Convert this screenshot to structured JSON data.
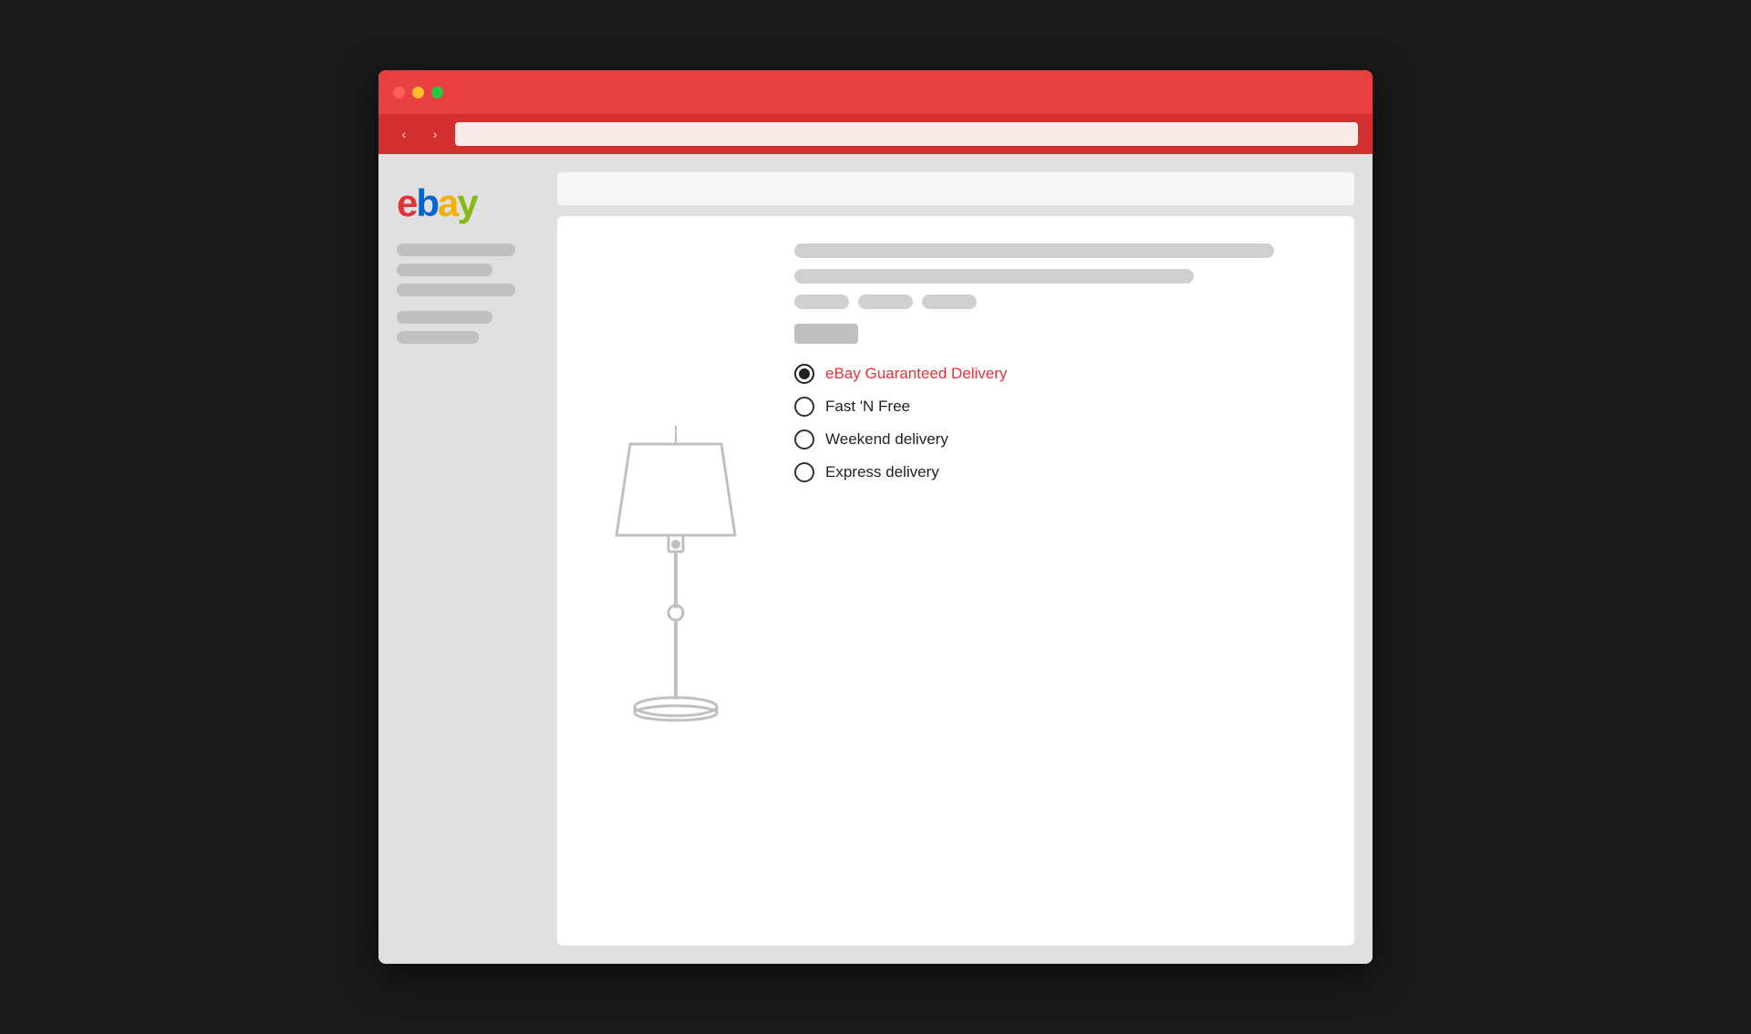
{
  "browser": {
    "title_bar": {
      "traffic_lights": [
        "red",
        "yellow",
        "green"
      ]
    },
    "nav": {
      "back_label": "‹",
      "forward_label": "›"
    }
  },
  "ebay": {
    "logo": {
      "e": "e",
      "b": "b",
      "a": "a",
      "y": "y"
    }
  },
  "sidebar": {
    "groups": [
      {
        "bars": [
          "wide",
          "medium",
          "wide"
        ]
      },
      {
        "bars": [
          "medium",
          "short"
        ]
      }
    ]
  },
  "delivery": {
    "options": [
      {
        "id": "guaranteed",
        "label": "eBay Guaranteed Delivery",
        "selected": true,
        "color": "ebay-red"
      },
      {
        "id": "fastnfree",
        "label": "Fast 'N Free",
        "selected": false,
        "color": "normal"
      },
      {
        "id": "weekend",
        "label": "Weekend delivery",
        "selected": false,
        "color": "normal"
      },
      {
        "id": "express",
        "label": "Express delivery",
        "selected": false,
        "color": "normal"
      }
    ]
  }
}
